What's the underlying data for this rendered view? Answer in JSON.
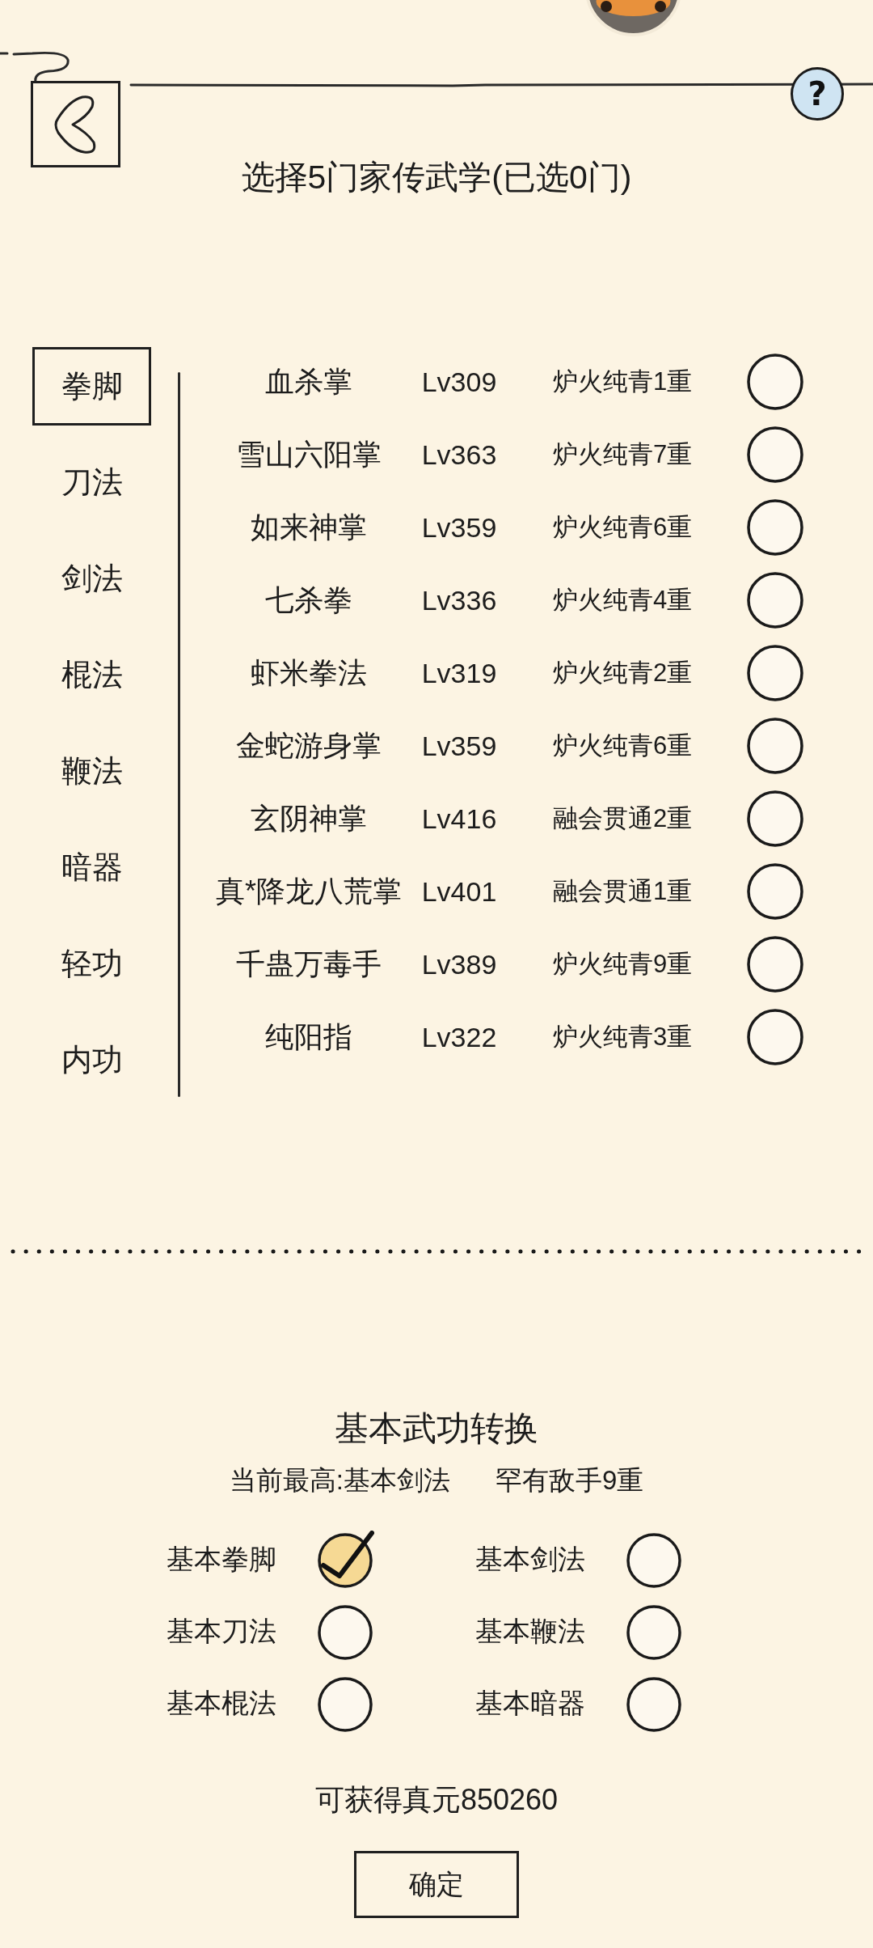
{
  "header": {
    "help": "?",
    "title": "选择5门家传武学(已选0门)"
  },
  "categories": [
    {
      "label": "拳脚",
      "selected": true
    },
    {
      "label": "刀法",
      "selected": false
    },
    {
      "label": "剑法",
      "selected": false
    },
    {
      "label": "棍法",
      "selected": false
    },
    {
      "label": "鞭法",
      "selected": false
    },
    {
      "label": "暗器",
      "selected": false
    },
    {
      "label": "轻功",
      "selected": false
    },
    {
      "label": "内功",
      "selected": false
    }
  ],
  "skills": [
    {
      "name": "血杀掌",
      "rank": "Lv309",
      "realm": "炉火纯青1重",
      "selected": false
    },
    {
      "name": "雪山六阳掌",
      "rank": "Lv363",
      "realm": "炉火纯青7重",
      "selected": false
    },
    {
      "name": "如来神掌",
      "rank": "Lv359",
      "realm": "炉火纯青6重",
      "selected": false
    },
    {
      "name": "七杀拳",
      "rank": "Lv336",
      "realm": "炉火纯青4重",
      "selected": false
    },
    {
      "name": "虾米拳法",
      "rank": "Lv319",
      "realm": "炉火纯青2重",
      "selected": false
    },
    {
      "name": "金蛇游身掌",
      "rank": "Lv359",
      "realm": "炉火纯青6重",
      "selected": false
    },
    {
      "name": "玄阴神掌",
      "rank": "Lv416",
      "realm": "融会贯通2重",
      "selected": false
    },
    {
      "name": "真*降龙八荒掌",
      "rank": "Lv401",
      "realm": "融会贯通1重",
      "selected": false
    },
    {
      "name": "千蛊万毒手",
      "rank": "Lv389",
      "realm": "炉火纯青9重",
      "selected": false
    },
    {
      "name": "纯阳指",
      "rank": "Lv322",
      "realm": "炉火纯青3重",
      "selected": false
    }
  ],
  "conversion": {
    "title": "基本武功转换",
    "current_best": "当前最高:基本剑法",
    "current_realm": "罕有敌手9重",
    "options": [
      {
        "label": "基本拳脚",
        "checked": true
      },
      {
        "label": "基本剑法",
        "checked": false
      },
      {
        "label": "基本刀法",
        "checked": false
      },
      {
        "label": "基本鞭法",
        "checked": false
      },
      {
        "label": "基本棍法",
        "checked": false
      },
      {
        "label": "基本暗器",
        "checked": false
      }
    ],
    "reward": "可获得真元850260",
    "confirm_button": "确定"
  }
}
